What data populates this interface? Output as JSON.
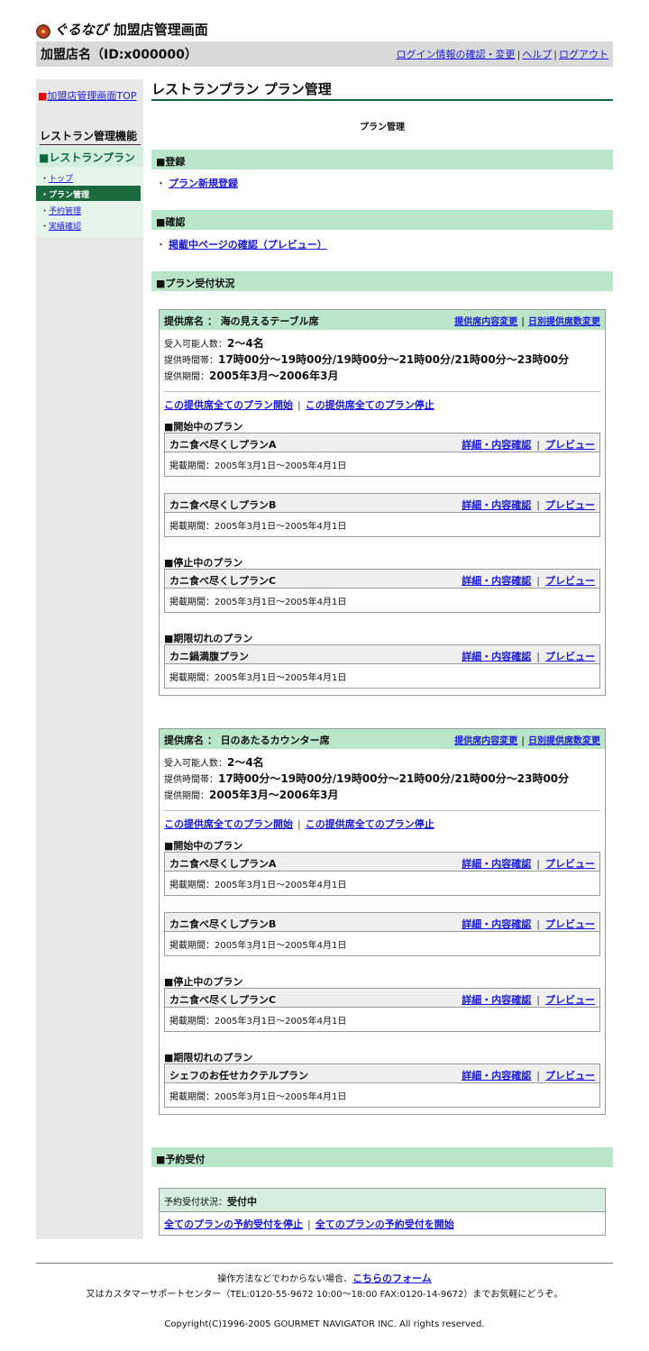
{
  "header": {
    "brand": "ぐるなび",
    "title": "加盟店管理画面",
    "store_name": "加盟店名（ID:x000000）",
    "links": [
      "ログイン情報の確認・変更",
      "ヘルプ",
      "ログアウト"
    ]
  },
  "sidebar": {
    "top_link": "加盟店管理画面TOP",
    "heading": "レストラン管理機能",
    "section": "■レストランプラン",
    "nav": [
      {
        "label": "トップ",
        "active": false
      },
      {
        "label": "プラン管理",
        "active": true
      },
      {
        "label": "予約管理",
        "active": false
      },
      {
        "label": "実績確認",
        "active": false
      }
    ]
  },
  "main": {
    "title": "レストランプラン プラン管理",
    "subtitle": "プラン管理",
    "sections": {
      "register": "■登録",
      "register_link": "プラン新規登録",
      "confirm": "■確認",
      "confirm_link": "掲載中ページの確認（プレビュー）",
      "status": "■プラン受付状況",
      "reservation": "■予約受付"
    },
    "seat_links": {
      "content_change": "提供席内容変更",
      "daily_change": "日別提供席数変更",
      "start_all": "この提供席全てのプラン開始",
      "stop_all": "この提供席全てのプラン停止"
    },
    "plan_links": {
      "detail": "詳細・内容確認",
      "preview": "プレビュー"
    },
    "groups": {
      "active": "■開始中のプラン",
      "stopped": "■停止中のプラン",
      "expired": "■期限切れのプラン"
    },
    "period_label": "掲載期間：",
    "seats": [
      {
        "name": "提供席名 ： 海の見えるテーブル席",
        "capacity_label": "受入可能人数：",
        "capacity": "2〜4名",
        "time_label": "提供時間帯：",
        "time": "17時00分〜19時00分/19時00分〜21時00分/21時00分〜23時00分",
        "range_label": "提供期間：",
        "range": "2005年3月〜2006年3月",
        "plans": [
          {
            "name": "カニ食べ尽くしプランA",
            "period": "2005年3月1日〜2005年4月1日"
          },
          {
            "name": "カニ食べ尽くしプランB",
            "period": "2005年3月1日〜2005年4月1日"
          },
          {
            "name": "カニ食べ尽くしプランC",
            "period": "2005年3月1日〜2005年4月1日"
          },
          {
            "name": "カニ鍋満腹プラン",
            "period": "2005年3月1日〜2005年4月1日"
          }
        ]
      },
      {
        "name": "提供席名 ： 日のあたるカウンター席",
        "capacity_label": "受入可能人数：",
        "capacity": "2〜4名",
        "time_label": "提供時間帯：",
        "time": "17時00分〜19時00分/19時00分〜21時00分/21時00分〜23時00分",
        "range_label": "提供期間：",
        "range": "2005年3月〜2006年3月",
        "plans": [
          {
            "name": "カニ食べ尽くしプランA",
            "period": "2005年3月1日〜2005年4月1日"
          },
          {
            "name": "カニ食べ尽くしプランB",
            "period": "2005年3月1日〜2005年4月1日"
          },
          {
            "name": "カニ食べ尽くしプランC",
            "period": "2005年3月1日〜2005年4月1日"
          },
          {
            "name": "シェフのお任せカクテルプラン",
            "period": "2005年3月1日〜2005年4月1日"
          }
        ]
      }
    ],
    "reservation": {
      "status_label": "予約受付状況：",
      "status": "受付中",
      "stop_all": "全てのプランの予約受付を停止",
      "start_all": "全てのプランの予約受付を開始"
    }
  },
  "footer": {
    "line1_prefix": "操作方法などでわからない場合、",
    "line1_link": "こちらのフォーム",
    "line2": "又はカスタマーサポートセンター（TEL:0120-55-9672 10:00〜18:00 FAX:0120-14-9672）までお気軽にどうぞ。",
    "copyright": "Copyright(C)1996-2005 GOURMET NAVIGATOR INC. All rights reserved."
  }
}
